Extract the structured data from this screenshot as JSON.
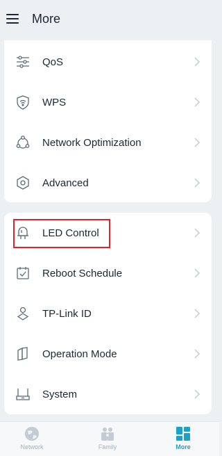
{
  "header": {
    "title": "More"
  },
  "group1": [
    {
      "label": "QoS",
      "icon": "sliders-icon"
    },
    {
      "label": "WPS",
      "icon": "shield-wifi-icon"
    },
    {
      "label": "Network Optimization",
      "icon": "network-optimization-icon"
    },
    {
      "label": "Advanced",
      "icon": "hexagon-gear-icon"
    }
  ],
  "group2": [
    {
      "label": "LED Control",
      "icon": "led-icon"
    },
    {
      "label": "Reboot Schedule",
      "icon": "calendar-check-icon"
    },
    {
      "label": "TP-Link ID",
      "icon": "user-id-icon"
    },
    {
      "label": "Operation Mode",
      "icon": "map-mode-icon"
    },
    {
      "label": "System",
      "icon": "router-system-icon"
    }
  ],
  "bottom_nav": [
    {
      "label": "Network",
      "icon": "globe-icon",
      "active": false
    },
    {
      "label": "Family",
      "icon": "family-icon",
      "active": false
    },
    {
      "label": "More",
      "icon": "grid-icon",
      "active": true
    }
  ],
  "colors": {
    "accent": "#1aa2c8",
    "highlight_box": "#d9262c",
    "icon_stroke": "#5a6b7a",
    "background": "#edf0f3"
  }
}
